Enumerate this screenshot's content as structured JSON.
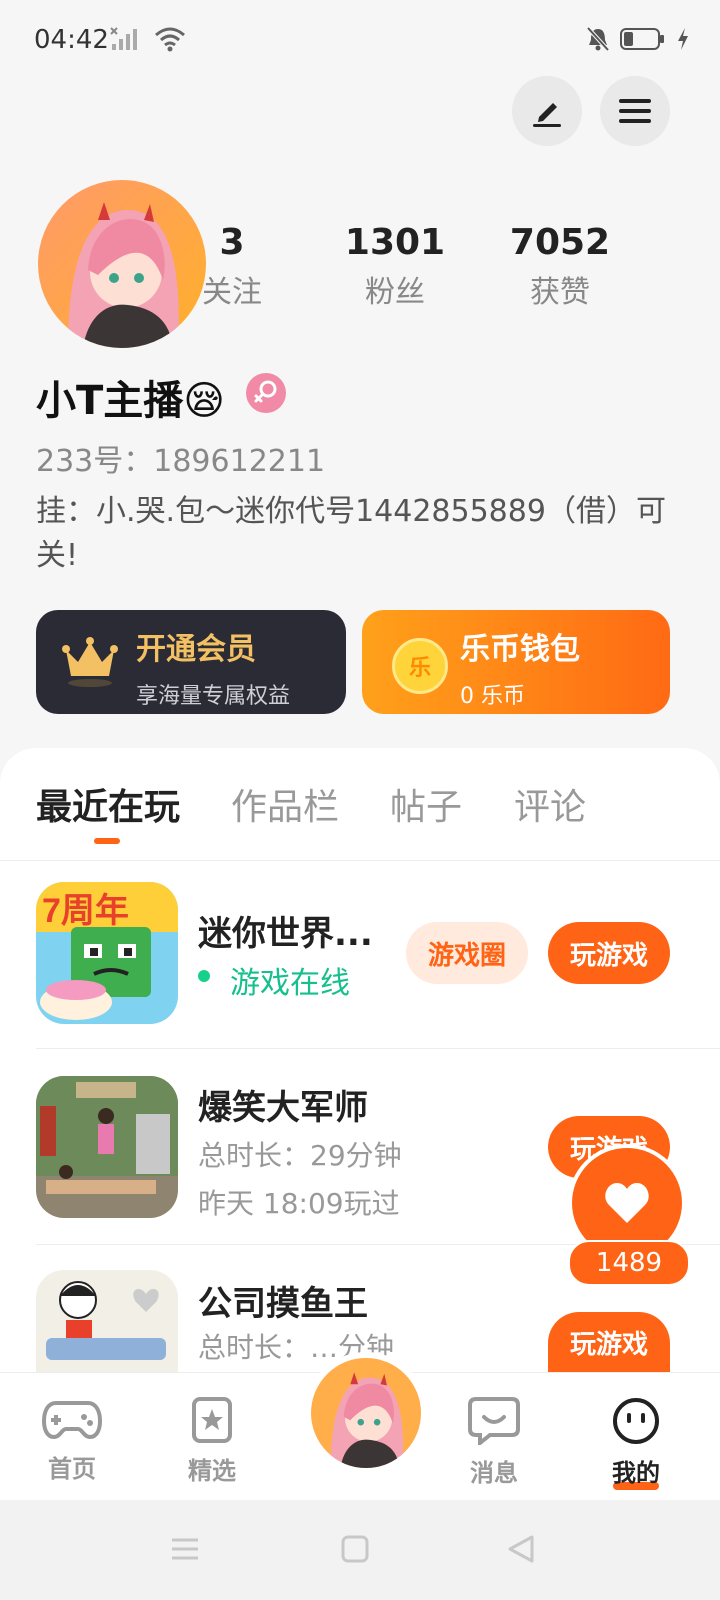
{
  "status_bar": {
    "time": "04:42"
  },
  "profile": {
    "following_count": "3",
    "following_label": "关注",
    "fans_count": "1301",
    "fans_label": "粉丝",
    "likes_count": "7052",
    "likes_label": "获赞",
    "username": "小T主播😪",
    "gender_icon": "female-icon",
    "id_line": "233号：189612211",
    "bio": "挂：小.哭.包～迷你代号1442855889（借）可关!"
  },
  "cards": {
    "vip": {
      "title": "开通会员",
      "subtitle": "享海量专属权益"
    },
    "wallet": {
      "title": "乐币钱包",
      "subtitle": "0 乐币",
      "coin_char": "乐"
    }
  },
  "tabs": [
    {
      "label": "最近在玩",
      "active": true
    },
    {
      "label": "作品栏"
    },
    {
      "label": "帖子"
    },
    {
      "label": "评论"
    }
  ],
  "games": [
    {
      "title": "迷你世界...",
      "status": "游戏在线",
      "circle_label": "游戏圈",
      "play_label": "玩游戏",
      "badge": "7周年"
    },
    {
      "title": "爆笑大军师",
      "duration": "总时长：29分钟",
      "last_played": "昨天 18:09玩过",
      "play_label": "玩游戏"
    },
    {
      "title": "公司摸鱼王",
      "duration": "总时长：…分钟",
      "play_label": "玩游戏"
    }
  ],
  "floating_like": {
    "count": "1489"
  },
  "bottom_nav": [
    {
      "label": "首页",
      "icon": "gamepad-icon"
    },
    {
      "label": "精选",
      "icon": "star-bookmark-icon"
    },
    {
      "label": "",
      "icon": "avatar"
    },
    {
      "label": "消息",
      "icon": "chat-bubble-icon"
    },
    {
      "label": "我的",
      "icon": "smile-face-icon",
      "active": true
    }
  ],
  "colors": {
    "accent": "#ff6416",
    "online": "#16c08c",
    "vip_bg": "#2b2b36"
  }
}
